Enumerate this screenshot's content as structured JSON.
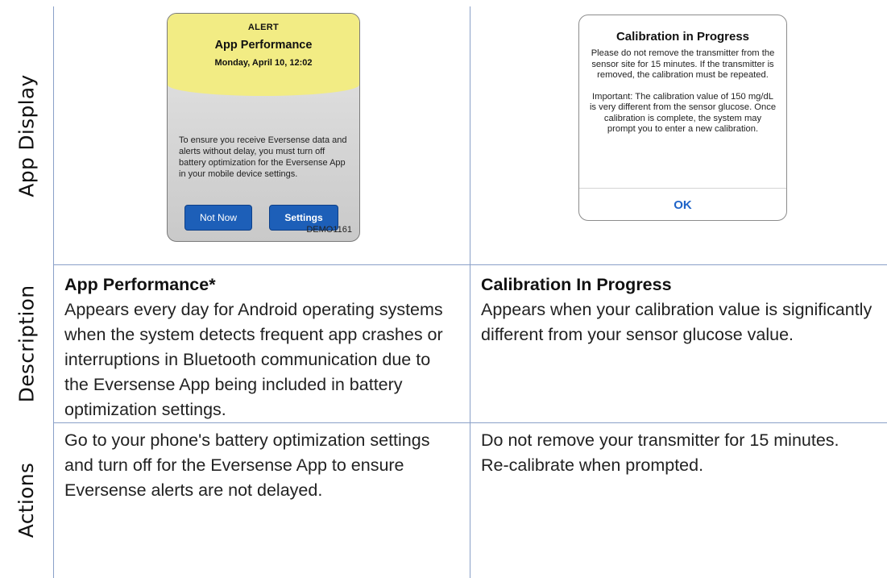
{
  "row_labels": {
    "app_display": "App Display",
    "description": "Description",
    "actions": "Actions"
  },
  "alert_screen": {
    "kicker": "ALERT",
    "title": "App Performance",
    "date": "Monday, April 10, 12:02",
    "body": "To ensure you receive Eversense data and alerts without delay, you must turn off battery optimization for the Eversense App in your mobile device settings.",
    "not_now_label": "Not Now",
    "settings_label": "Settings",
    "code": "DEMO1161",
    "header_color": "#f2ec84",
    "button_color": "#1d5fb8"
  },
  "calibration_screen": {
    "title": "Calibration in Progress",
    "paragraph1": "Please do not remove the transmitter from the sensor site for 15 minutes. If the transmitter is removed, the calibration must be repeated.",
    "paragraph2": "Important: The calibration value of 150 mg/dL is very different from the sensor glucose. Once calibration is complete, the system may prompt you to enter a new calibration.",
    "ok_label": "OK",
    "ok_color": "#1f64c8"
  },
  "description": {
    "left_title": "App Performance*",
    "left_text": "Appears every day for Android operating systems when the system detects frequent app crashes or interruptions in Bluetooth communication due to the Eversense App being included in battery optimization settings.",
    "right_title": "Calibration In Progress",
    "right_text": "Appears when your calibration value is significantly different from your sensor glucose value."
  },
  "actions": {
    "left_text": "Go to your phone's battery optimization settings and turn off for the Eversense App to ensure Eversense alerts are not delayed.",
    "right_line1": "Do not remove your transmitter for 15 minutes.",
    "right_line2": "Re-calibrate when prompted."
  },
  "grid_color": "#8aa0c8"
}
